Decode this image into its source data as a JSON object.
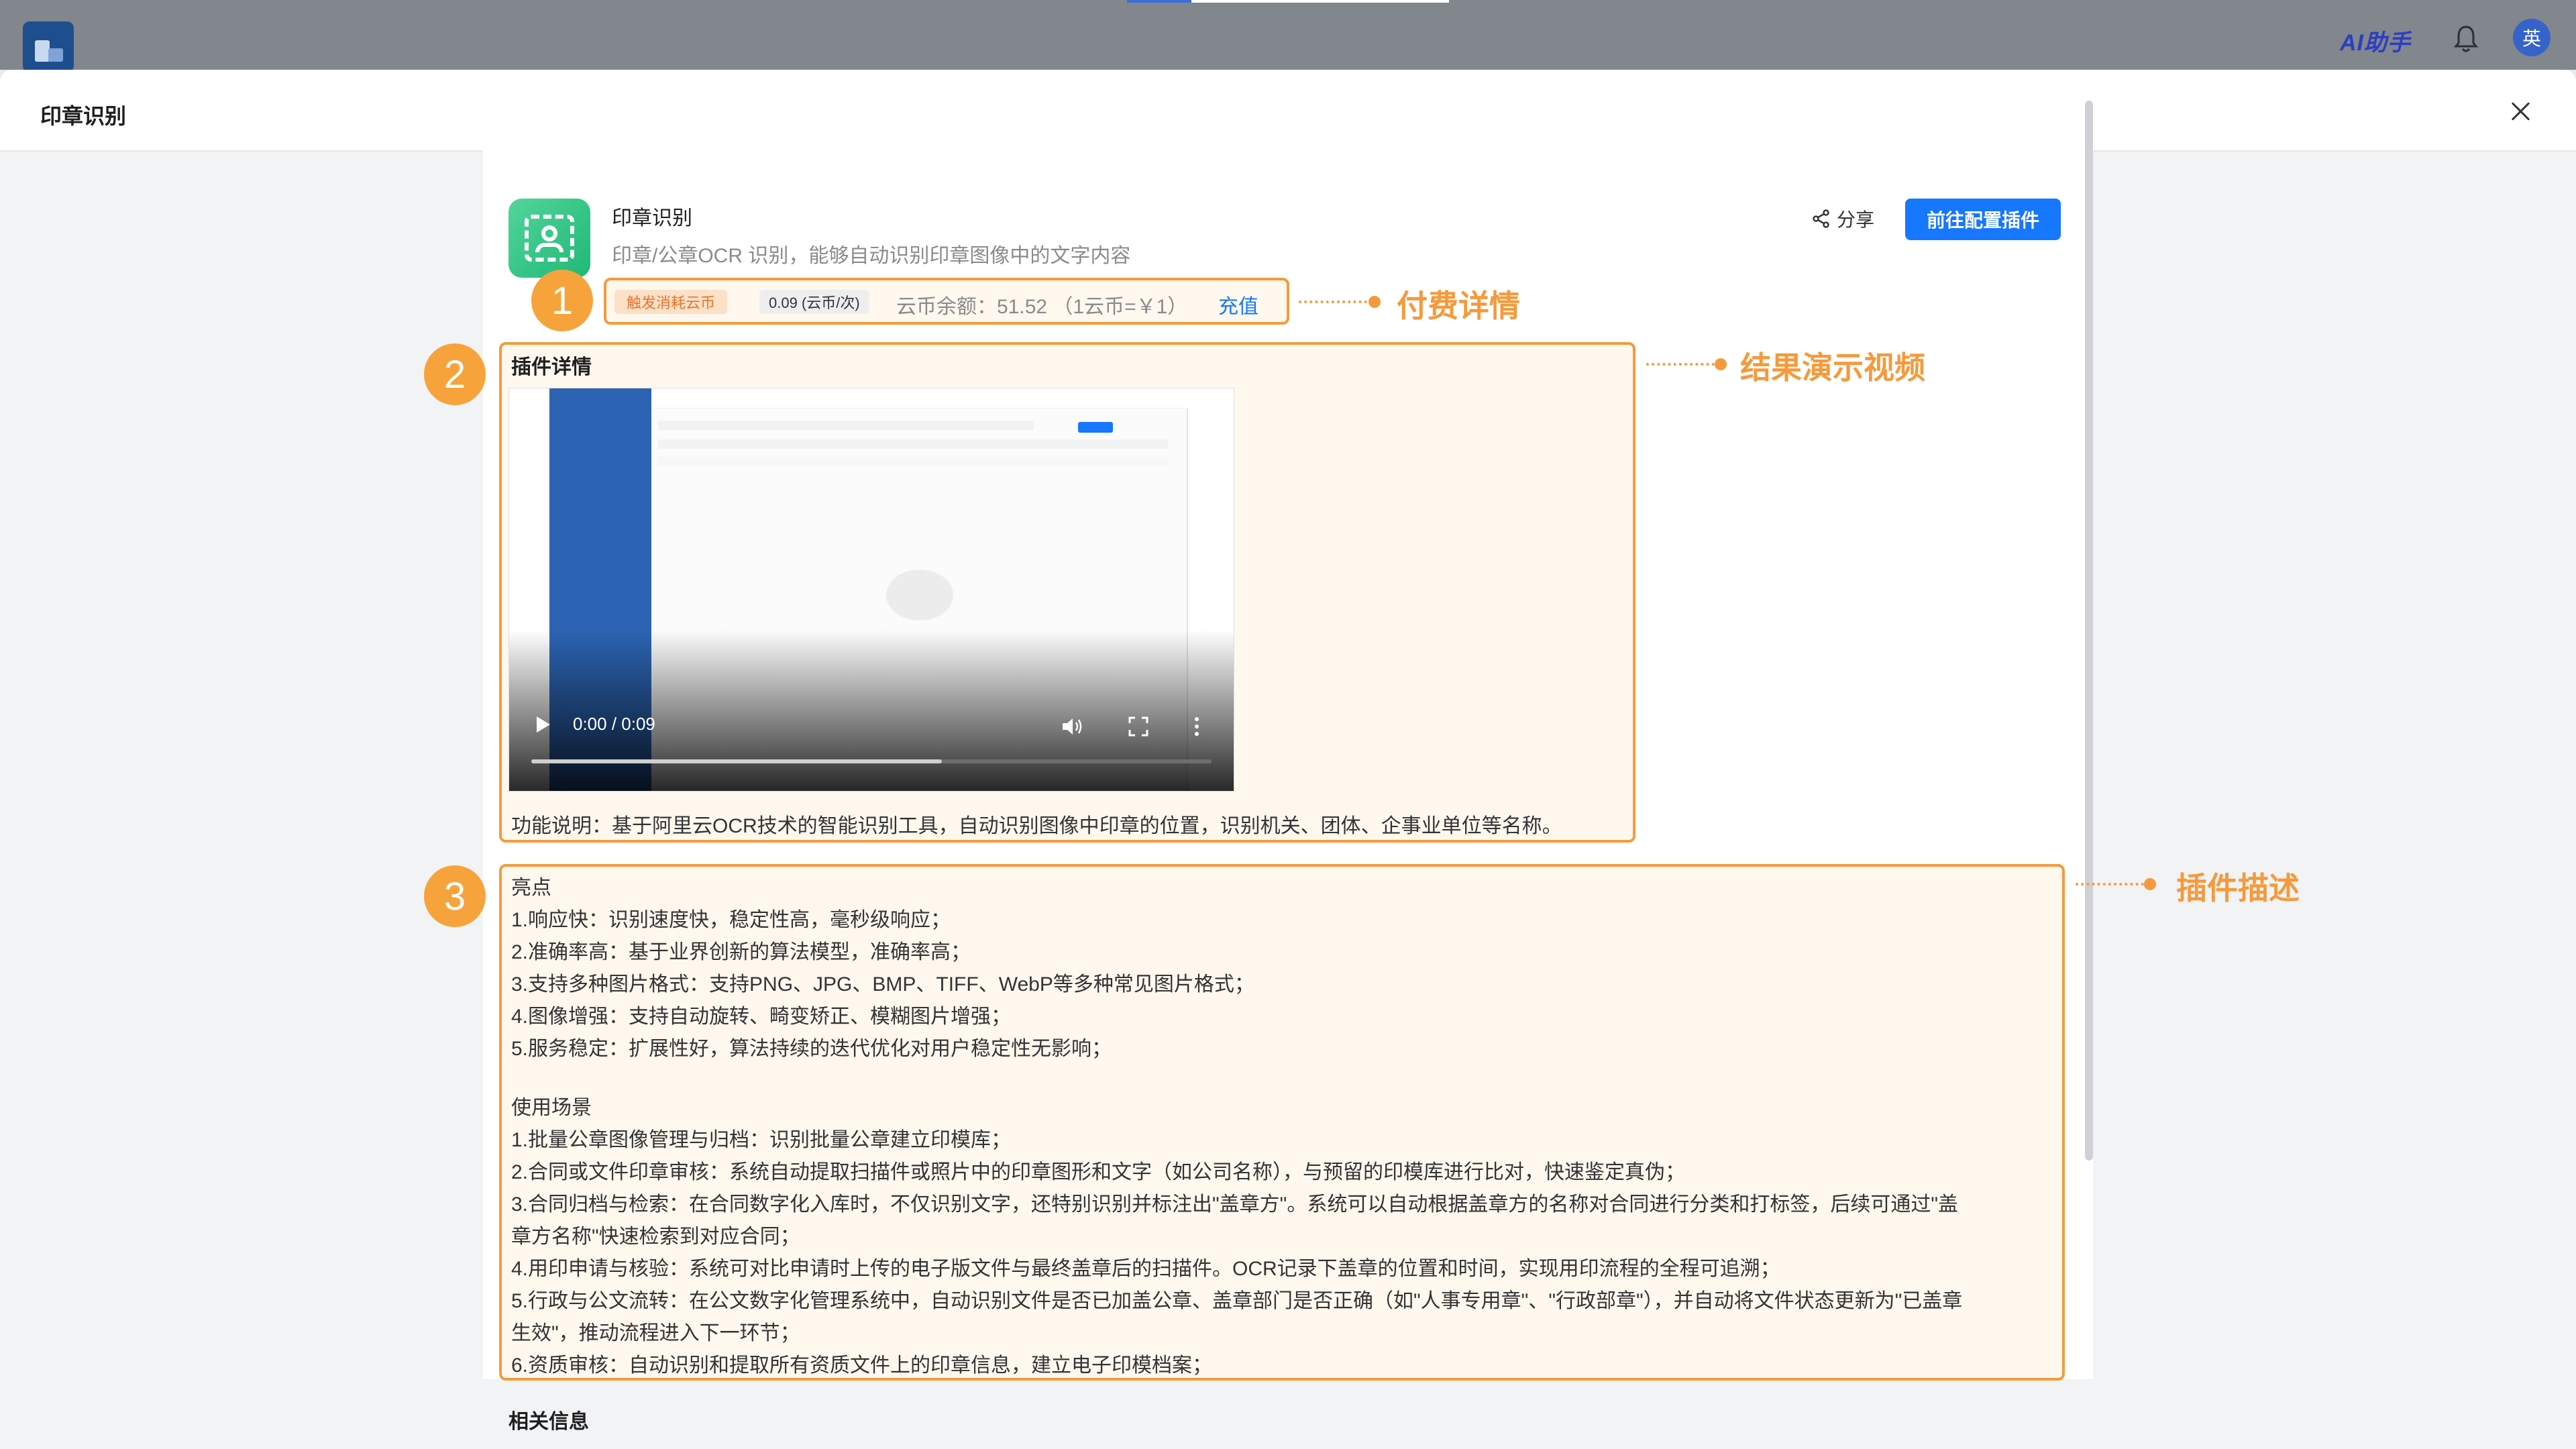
{
  "app": {
    "ai_helper_label": "AI助手",
    "avatar_text": "英"
  },
  "modal": {
    "title": "印章识别"
  },
  "plugin": {
    "name": "印章识别",
    "description": "印章/公章OCR 识别，能够自动识别印章图像中的文字内容",
    "share_label": "分享",
    "config_button_label": "前往配置插件"
  },
  "pricing": {
    "trigger_badge": "触发消耗云币",
    "rate": "0.09 (云币/次)",
    "balance": "云币余额：51.52 （1云币=￥1）",
    "recharge_label": "充值"
  },
  "details": {
    "title": "插件详情",
    "video_time": "0:00 / 0:09",
    "video_progress": 0.0,
    "function_description": "功能说明：基于阿里云OCR技术的智能识别工具，自动识别图像中印章的位置，识别机关、团体、企事业单位等名称。"
  },
  "description": {
    "highlights_title": "亮点",
    "highlights": [
      "1.响应快：识别速度快，稳定性高，毫秒级响应；",
      "2.准确率高：基于业界创新的算法模型，准确率高；",
      "3.支持多种图片格式：支持PNG、JPG、BMP、TIFF、WebP等多种常见图片格式；",
      "4.图像增强：支持自动旋转、畸变矫正、模糊图片增强；",
      "5.服务稳定：扩展性好，算法持续的迭代优化对用户稳定性无影响；"
    ],
    "scenarios_title": "使用场景",
    "scenarios": [
      "1.批量公章图像管理与归档：识别批量公章建立印模库；",
      "2.合同或文件印章审核：系统自动提取扫描件或照片中的印章图形和文字（如公司名称），与预留的印模库进行比对，快速鉴定真伪；",
      "3.合同归档与检索：在合同数字化入库时，不仅识别文字，还特别识别并标注出\"盖章方\"。系统可以自动根据盖章方的名称对合同进行分类和打标签，后续可通过\"盖",
      "章方名称\"快速检索到对应合同；",
      "4.用印申请与核验：系统可对比申请时上传的电子版文件与最终盖章后的扫描件。OCR记录下盖章的位置和时间，实现用印流程的全程可追溯；",
      "5.行政与公文流转：在公文数字化管理系统中，自动识别文件是否已加盖公章、盖章部门是否正确（如\"人事专用章\"、\"行政部章\"），并自动将文件状态更新为\"已盖章",
      "生效\"，推动流程进入下一环节；",
      "6.资质审核：自动识别和提取所有资质文件上的印章信息，建立电子印模档案；"
    ],
    "related_title": "相关信息"
  },
  "callouts": [
    {
      "number": "1",
      "label": "付费详情"
    },
    {
      "number": "2",
      "label": "结果演示视频"
    },
    {
      "number": "3",
      "label": "插件描述"
    }
  ],
  "colors": {
    "accent": "#f59a3c",
    "primary": "#1677ff",
    "plugin_icon": "#2ec985"
  },
  "icons": [
    "bell-icon",
    "share-icon",
    "close-icon",
    "play-icon",
    "volume-icon",
    "fullscreen-icon",
    "more-icon"
  ]
}
